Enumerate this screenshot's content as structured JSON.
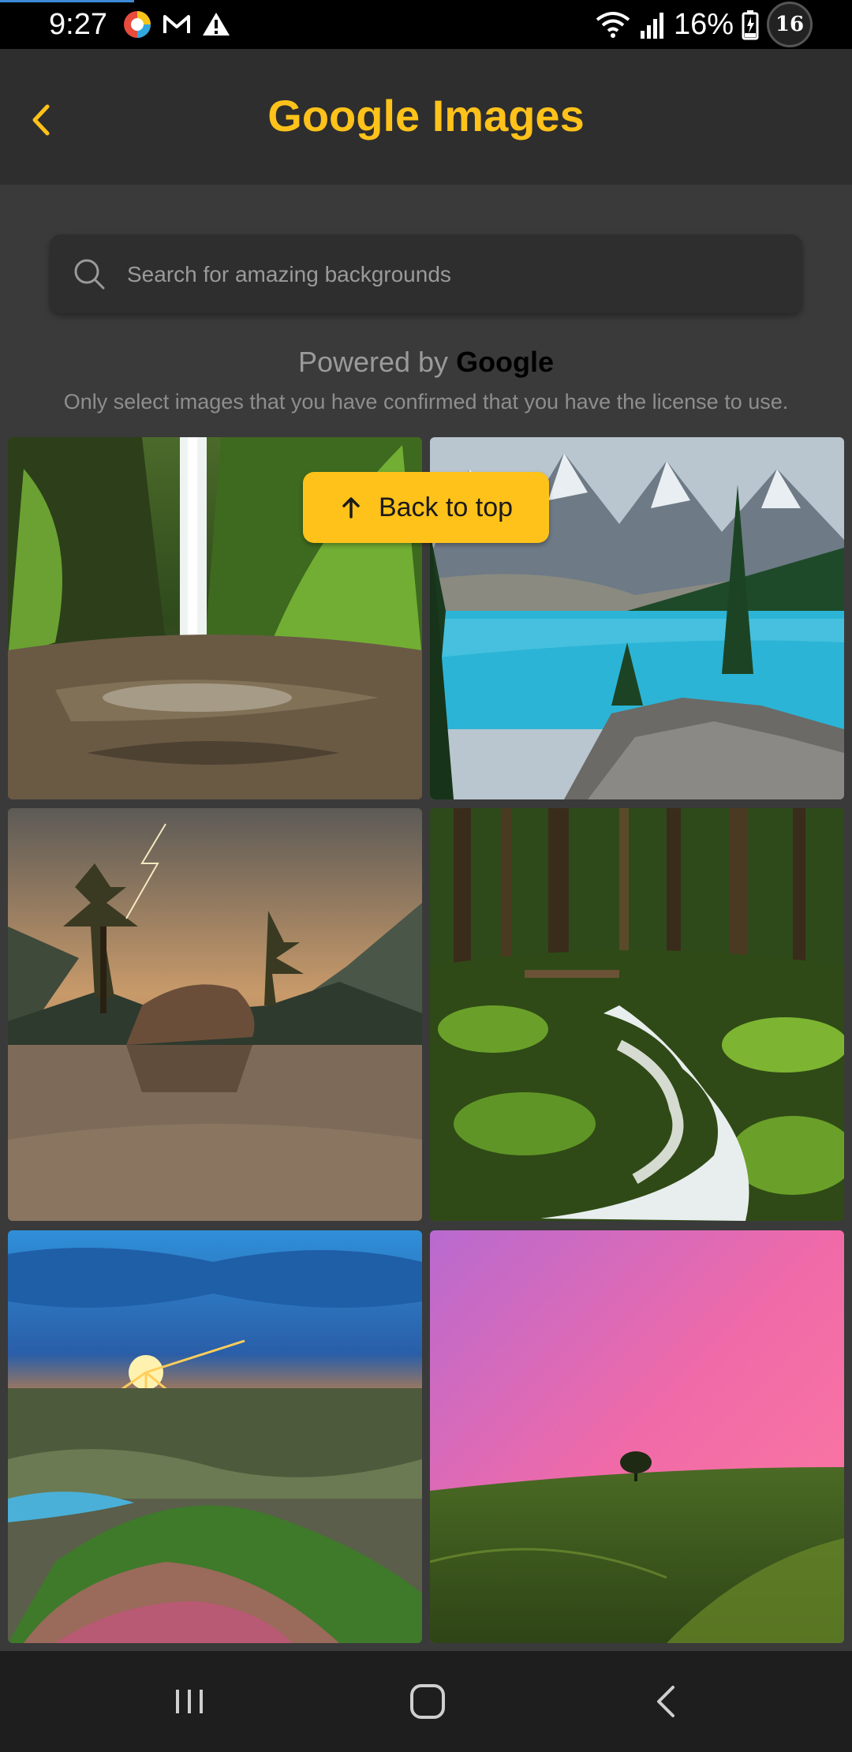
{
  "status_bar": {
    "time": "9:27",
    "battery": "16%",
    "badge": "16",
    "icons": [
      "color-app-icon",
      "gmail-icon",
      "warning-icon",
      "wifi-icon",
      "signal-icon",
      "battery-icon"
    ]
  },
  "header": {
    "title": "Google Images",
    "back_icon": "chevron-left-icon",
    "accent_color": "#ffc21a"
  },
  "search": {
    "placeholder": "Search for amazing backgrounds",
    "value": ""
  },
  "powered_by": {
    "prefix": "Powered by",
    "brand": "Google"
  },
  "license_note": "Only select images that you have confirmed that you have the license to use.",
  "back_to_top": {
    "label": "Back to top",
    "icon": "arrow-up-icon"
  },
  "images": [
    {
      "subject": "waterfall in mossy canyon"
    },
    {
      "subject": "turquoise mountain lake"
    },
    {
      "subject": "lake island with trees under storm"
    },
    {
      "subject": "mossy forest stream"
    },
    {
      "subject": "sunset over valley"
    },
    {
      "subject": "pink sky over green hill"
    }
  ],
  "nav_bar": {
    "items": [
      "recents-icon",
      "home-icon",
      "back-icon"
    ]
  }
}
